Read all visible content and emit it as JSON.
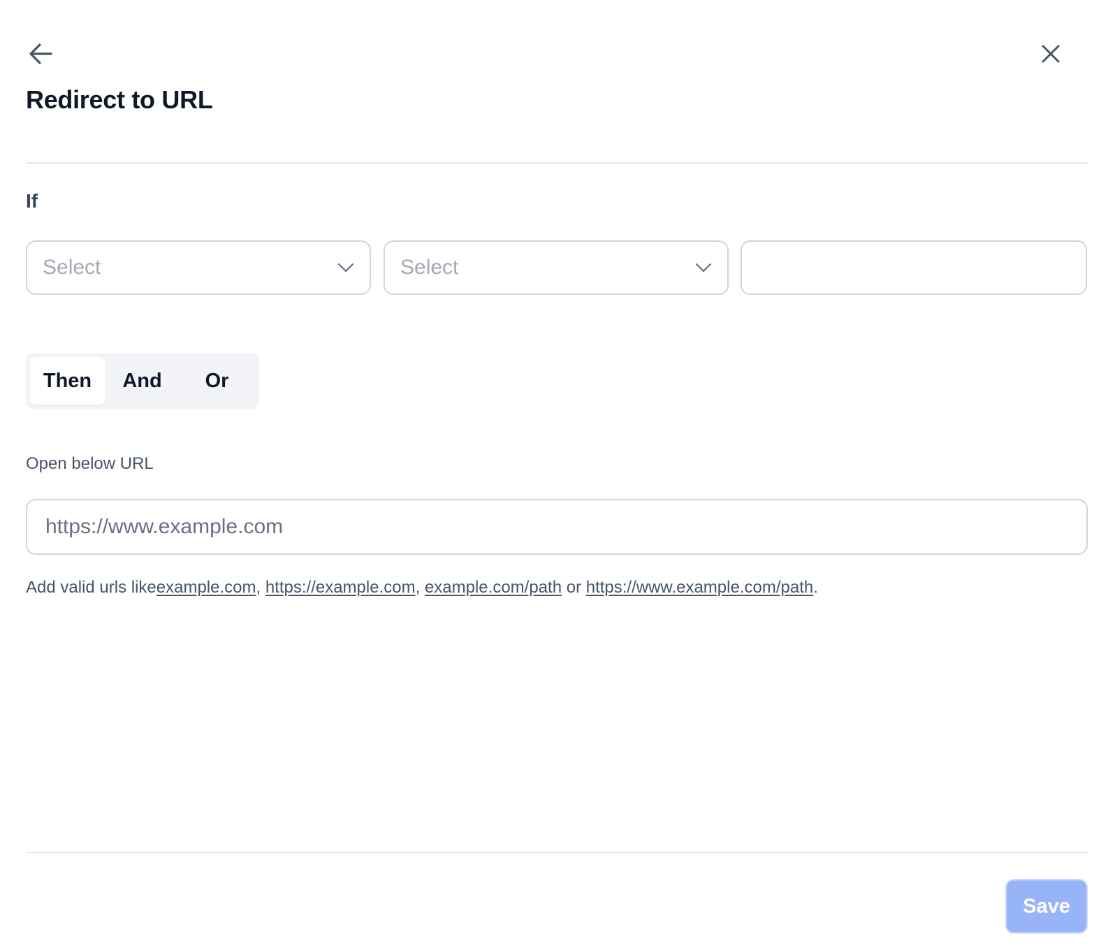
{
  "header": {
    "back_icon": "arrow-left-icon",
    "close_icon": "close-icon",
    "title": "Redirect to URL"
  },
  "condition": {
    "label": "If",
    "field_select": {
      "placeholder": "Select"
    },
    "operator_select": {
      "placeholder": "Select"
    },
    "value_input": {
      "value": "",
      "placeholder": ""
    }
  },
  "connector": {
    "options": [
      {
        "label": "Then",
        "selected": true
      },
      {
        "label": "And",
        "selected": false
      },
      {
        "label": "Or",
        "selected": false
      }
    ]
  },
  "action": {
    "label": "Open below URL",
    "url_input": {
      "value": "",
      "placeholder": "https://www.example.com"
    },
    "hint": {
      "prefix": "Add valid urls like",
      "links": [
        "example.com",
        "https://example.com",
        "example.com/path",
        "https://www.example.com/path"
      ],
      "sep1": ", ",
      "sep2": ", ",
      "sep3": " or ",
      "suffix": "."
    }
  },
  "footer": {
    "save_label": "Save"
  },
  "colors": {
    "save_button": "#98b4f9",
    "border": "#d0d5dd",
    "segment_bg": "#f2f4f7",
    "title": "#101828"
  }
}
